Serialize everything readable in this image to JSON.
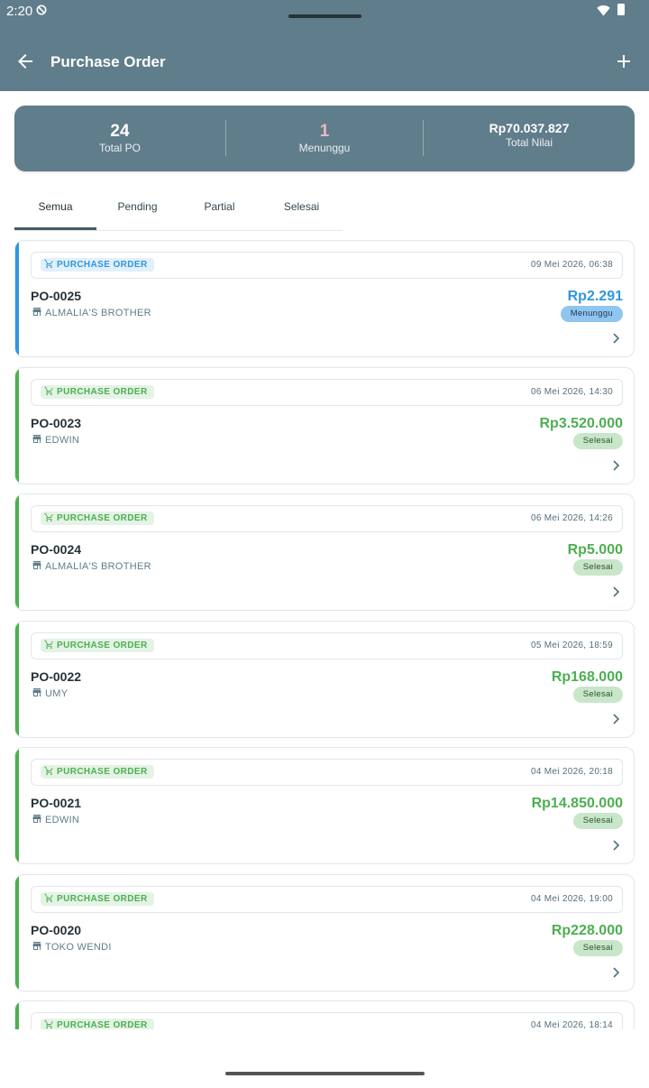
{
  "status_bar": {
    "time": "2:20"
  },
  "header": {
    "title": "Purchase Order"
  },
  "summary": {
    "total_po": {
      "value": "24",
      "label": "Total PO"
    },
    "waiting": {
      "value": "1",
      "label": "Menunggu"
    },
    "total_value": {
      "value": "Rp70.037.827",
      "label": "Total Nilai"
    }
  },
  "tabs": [
    {
      "label": "Semua",
      "active": true
    },
    {
      "label": "Pending",
      "active": false
    },
    {
      "label": "Partial",
      "active": false
    },
    {
      "label": "Selesai",
      "active": false
    }
  ],
  "colors": {
    "app_bar": "#607D8B",
    "waiting_blue": "#2F96DE",
    "done_green": "#4CAF50",
    "waiting_pink": "#F0B6C8"
  },
  "orders": [
    {
      "type": "PURCHASE ORDER",
      "date": "09 Mei 2026, 06:38",
      "number": "PO-0025",
      "supplier": "ALMALIA'S BROTHER",
      "amount": "Rp2.291",
      "status": "Menunggu",
      "state": "waiting"
    },
    {
      "type": "PURCHASE ORDER",
      "date": "06 Mei 2026, 14:30",
      "number": "PO-0023",
      "supplier": "EDWIN",
      "amount": "Rp3.520.000",
      "status": "Selesai",
      "state": "done"
    },
    {
      "type": "PURCHASE ORDER",
      "date": "06 Mei 2026, 14:26",
      "number": "PO-0024",
      "supplier": "ALMALIA'S BROTHER",
      "amount": "Rp5.000",
      "status": "Selesai",
      "state": "done"
    },
    {
      "type": "PURCHASE ORDER",
      "date": "05 Mei 2026, 18:59",
      "number": "PO-0022",
      "supplier": "UMY",
      "amount": "Rp168.000",
      "status": "Selesai",
      "state": "done"
    },
    {
      "type": "PURCHASE ORDER",
      "date": "04 Mei 2026, 20:18",
      "number": "PO-0021",
      "supplier": "EDWIN",
      "amount": "Rp14.850.000",
      "status": "Selesai",
      "state": "done"
    },
    {
      "type": "PURCHASE ORDER",
      "date": "04 Mei 2026, 19:00",
      "number": "PO-0020",
      "supplier": "TOKO WENDI",
      "amount": "Rp228.000",
      "status": "Selesai",
      "state": "done"
    },
    {
      "type": "PURCHASE ORDER",
      "date": "04 Mei 2026, 18:14",
      "number": "",
      "supplier": "",
      "amount": "",
      "status": "",
      "state": "done"
    }
  ]
}
